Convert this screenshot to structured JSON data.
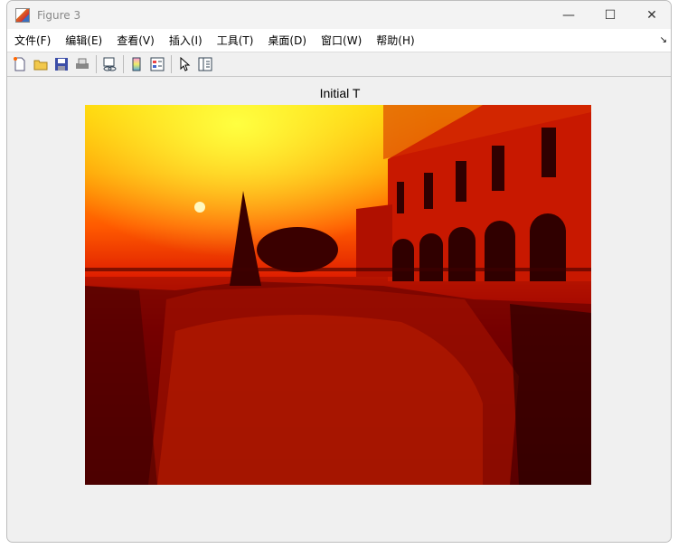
{
  "window": {
    "title": "Figure 3",
    "minimize": "—",
    "maximize": "☐",
    "close": "✕"
  },
  "menu": [
    {
      "label": "文件(F)"
    },
    {
      "label": "编辑(E)"
    },
    {
      "label": "查看(V)"
    },
    {
      "label": "插入(I)"
    },
    {
      "label": "工具(T)"
    },
    {
      "label": "桌面(D)"
    },
    {
      "label": "窗口(W)"
    },
    {
      "label": "帮助(H)"
    }
  ],
  "menu_overflow": "↘",
  "toolbar": [
    "new-figure-icon",
    "open-icon",
    "save-icon",
    "print-icon",
    "link-icon",
    "colorbar-icon",
    "legend-icon",
    "pointer-icon",
    "property-editor-icon"
  ],
  "axes": {
    "title": "Initial T"
  }
}
